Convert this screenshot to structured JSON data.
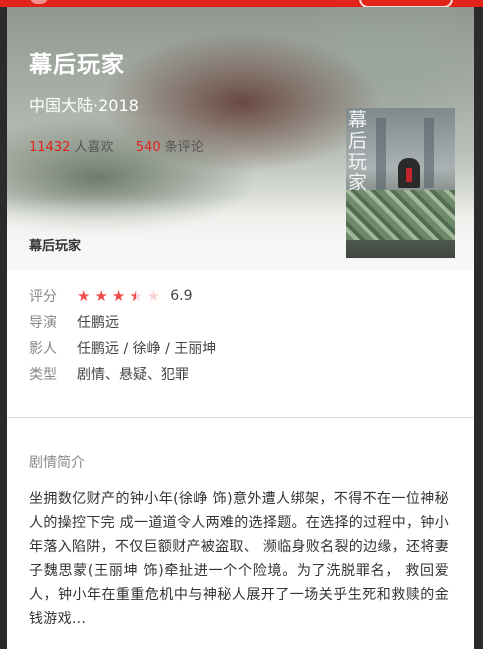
{
  "movie": {
    "title": "幕后玩家",
    "region_year": "中国大陆·2018",
    "likes_count": "11432",
    "likes_label": "人喜欢",
    "comments_count": "540",
    "comments_label": "条评论",
    "subtitle": "幕后玩家",
    "poster_title": "幕后玩家"
  },
  "details": {
    "rating_label": "评分",
    "rating_value": "6.9",
    "rating_stars": 3.5,
    "director_label": "导演",
    "director": "任鹏远",
    "cast_label": "影人",
    "cast": "任鹏远 / 徐峥 / 王丽坤",
    "genre_label": "类型",
    "genre": "剧情、悬疑、犯罪"
  },
  "synopsis": {
    "title": "剧情简介",
    "text": "坐拥数亿财产的钟小年(徐峥 饰)意外遭人绑架，不得不在一位神秘人的操控下完 成一道道令人两难的选择题。在选择的过程中，钟小年落入陷阱，不仅巨额财产被盗取、 濒临身败名裂的边缘，还将妻子魏思蒙(王丽坤 饰)牵扯进一个个险境。为了洗脱罪名， 救回爱人，钟小年在重重危机中与神秘人展开了一场关乎生死和救赎的金钱游戏..."
  },
  "colors": {
    "accent": "#e2231a",
    "star": "#ef4d4d"
  }
}
